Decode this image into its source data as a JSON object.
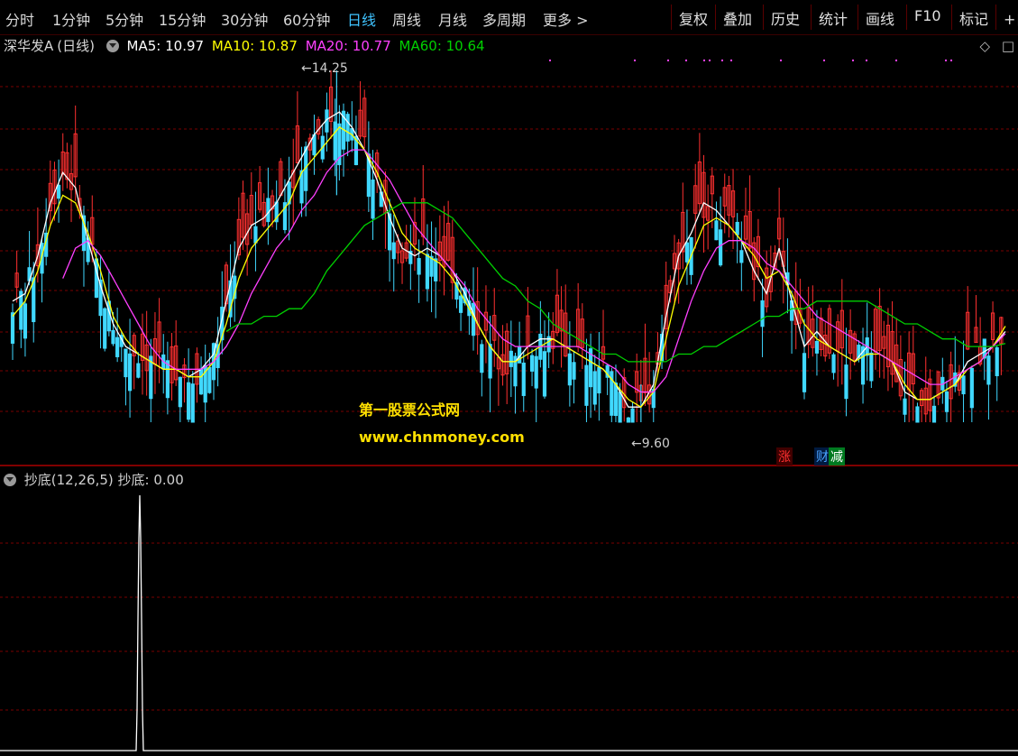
{
  "toolbar": {
    "tabs": [
      {
        "label": "分时",
        "active": false
      },
      {
        "label": "1分钟",
        "active": false
      },
      {
        "label": "5分钟",
        "active": false
      },
      {
        "label": "15分钟",
        "active": false
      },
      {
        "label": "30分钟",
        "active": false
      },
      {
        "label": "60分钟",
        "active": false
      },
      {
        "label": "日线",
        "active": true
      },
      {
        "label": "周线",
        "active": false
      },
      {
        "label": "月线",
        "active": false
      },
      {
        "label": "多周期",
        "active": false
      },
      {
        "label": "更多",
        "active": false
      }
    ],
    "more_chevron": ">",
    "right_buttons": [
      "复权",
      "叠加",
      "历史",
      "统计",
      "画线",
      "F10",
      "标记",
      "+自"
    ]
  },
  "legend": {
    "stock_name": "深华发A",
    "period": "(日线)",
    "ma5": "MA5: 10.97",
    "ma10": "MA10: 10.87",
    "ma20": "MA20: 10.77",
    "ma60": "MA60: 10.64"
  },
  "right_icons": [
    "◇",
    "□"
  ],
  "annotations": {
    "high_label": "14.25",
    "low_label": "9.60",
    "badge_up": "涨",
    "badge_finance": "财",
    "badge_reduce": "减"
  },
  "watermark": {
    "line1": "第一股票公式网",
    "line2": "www.chnmoney.com"
  },
  "indicator": {
    "name": "抄底(12,26,5)",
    "value_label": "抄底: 0.00"
  },
  "colors": {
    "ma5": "#ffffff",
    "ma10": "#ffff00",
    "ma20": "#ff40ff",
    "ma60": "#00d000",
    "up": "#ff3030",
    "down": "#40d8ff",
    "active_tab": "#3fc3ff",
    "grid": "#7a0000"
  },
  "chart_data": {
    "type": "candlestick",
    "high": 14.25,
    "low": 9.6,
    "ma_lines": [
      {
        "name": "MA5",
        "value": 10.97,
        "values": [
          11.2,
          11.3,
          11.8,
          12.5,
          12.9,
          12.7,
          12.0,
          11.4,
          10.9,
          10.6,
          10.5,
          10.4,
          10.3,
          10.3,
          10.2,
          10.3,
          10.5,
          11.2,
          11.9,
          12.2,
          12.3,
          12.5,
          12.8,
          13.1,
          13.4,
          13.6,
          13.7,
          13.5,
          13.2,
          12.8,
          12.3,
          11.9,
          11.8,
          11.9,
          11.8,
          11.6,
          11.3,
          10.9,
          10.6,
          10.4,
          10.4,
          10.6,
          10.7,
          10.7,
          10.6,
          10.5,
          10.4,
          10.3,
          10.1,
          9.8,
          9.8,
          10.1,
          11.0,
          11.8,
          12.1,
          12.5,
          12.4,
          12.2,
          12.0,
          11.6,
          11.3,
          11.9,
          11.2,
          10.6,
          10.8,
          10.6,
          10.5,
          10.4,
          10.6,
          10.5,
          10.4,
          10.0,
          9.9,
          9.9,
          10.0,
          10.1,
          10.4,
          10.5,
          10.6,
          10.8
        ]
      },
      {
        "name": "MA10",
        "value": 10.87,
        "values": [
          11.0,
          11.2,
          11.6,
          12.2,
          12.6,
          12.5,
          12.1,
          11.6,
          11.0,
          10.7,
          10.5,
          10.4,
          10.3,
          10.3,
          10.2,
          10.2,
          10.4,
          10.9,
          11.5,
          11.9,
          12.1,
          12.3,
          12.5,
          12.9,
          13.1,
          13.3,
          13.5,
          13.4,
          13.2,
          12.9,
          12.5,
          12.1,
          11.9,
          11.8,
          11.7,
          11.5,
          11.2,
          10.9,
          10.6,
          10.4,
          10.4,
          10.5,
          10.6,
          10.7,
          10.6,
          10.5,
          10.4,
          10.3,
          10.1,
          9.9,
          9.8,
          10.0,
          10.7,
          11.4,
          11.8,
          12.2,
          12.3,
          12.2,
          12.0,
          11.8,
          11.5,
          11.6,
          11.3,
          10.9,
          10.7,
          10.6,
          10.5,
          10.4,
          10.5,
          10.5,
          10.4,
          10.1,
          9.9,
          9.9,
          10.0,
          10.1,
          10.3,
          10.4,
          10.6,
          10.87
        ]
      },
      {
        "name": "MA20",
        "value": 10.77,
        "values": [
          null,
          null,
          null,
          null,
          11.5,
          11.9,
          12.0,
          11.8,
          11.5,
          11.2,
          10.9,
          10.6,
          10.4,
          10.3,
          10.3,
          10.3,
          10.4,
          10.6,
          10.9,
          11.3,
          11.6,
          11.9,
          12.1,
          12.4,
          12.6,
          12.9,
          13.1,
          13.2,
          13.2,
          13.0,
          12.8,
          12.5,
          12.2,
          12.0,
          11.8,
          11.6,
          11.4,
          11.1,
          10.9,
          10.7,
          10.6,
          10.6,
          10.6,
          10.6,
          10.6,
          10.6,
          10.5,
          10.4,
          10.3,
          10.1,
          10.0,
          10.0,
          10.2,
          10.7,
          11.2,
          11.6,
          11.9,
          12.0,
          12.0,
          11.9,
          11.7,
          11.6,
          11.4,
          11.2,
          11.0,
          10.9,
          10.8,
          10.7,
          10.6,
          10.5,
          10.4,
          10.3,
          10.2,
          10.1,
          10.1,
          10.2,
          10.3,
          10.4,
          10.6,
          10.77
        ]
      },
      {
        "name": "MA60",
        "value": 10.64,
        "values": [
          null,
          null,
          null,
          null,
          null,
          null,
          null,
          null,
          null,
          null,
          null,
          null,
          null,
          null,
          null,
          null,
          null,
          10.8,
          10.9,
          10.9,
          11.0,
          11.0,
          11.1,
          11.1,
          11.3,
          11.6,
          11.8,
          12.0,
          12.2,
          12.3,
          12.4,
          12.5,
          12.5,
          12.5,
          12.4,
          12.3,
          12.1,
          11.9,
          11.7,
          11.5,
          11.4,
          11.2,
          11.1,
          10.9,
          10.8,
          10.7,
          10.6,
          10.5,
          10.5,
          10.4,
          10.4,
          10.4,
          10.4,
          10.5,
          10.5,
          10.6,
          10.6,
          10.7,
          10.8,
          10.9,
          11.0,
          11.0,
          11.1,
          11.1,
          11.2,
          11.2,
          11.2,
          11.2,
          11.2,
          11.1,
          11.0,
          10.9,
          10.9,
          10.8,
          10.7,
          10.7,
          10.6,
          10.6,
          10.6,
          10.64
        ]
      }
    ],
    "indicator_series": {
      "name": "抄底",
      "value": 0.0,
      "values": [
        0,
        0,
        0,
        0,
        0,
        0,
        0,
        0,
        0,
        0,
        0,
        0,
        0,
        0,
        0,
        0,
        0,
        0,
        0,
        0,
        0,
        0,
        0,
        0,
        0,
        0,
        0,
        0,
        0,
        0,
        0,
        0,
        0,
        0,
        0,
        0,
        0,
        0,
        0,
        0,
        0,
        0,
        0,
        0,
        0,
        0,
        0,
        0,
        0,
        0,
        0,
        0,
        0,
        0,
        0,
        0,
        0,
        0,
        0,
        0,
        0,
        0,
        0,
        0,
        0,
        0,
        0,
        0,
        0,
        0,
        0,
        0,
        0,
        0,
        0,
        0,
        0,
        0,
        0,
        0
      ],
      "spike": {
        "index": 8,
        "value": 1.0
      }
    }
  }
}
